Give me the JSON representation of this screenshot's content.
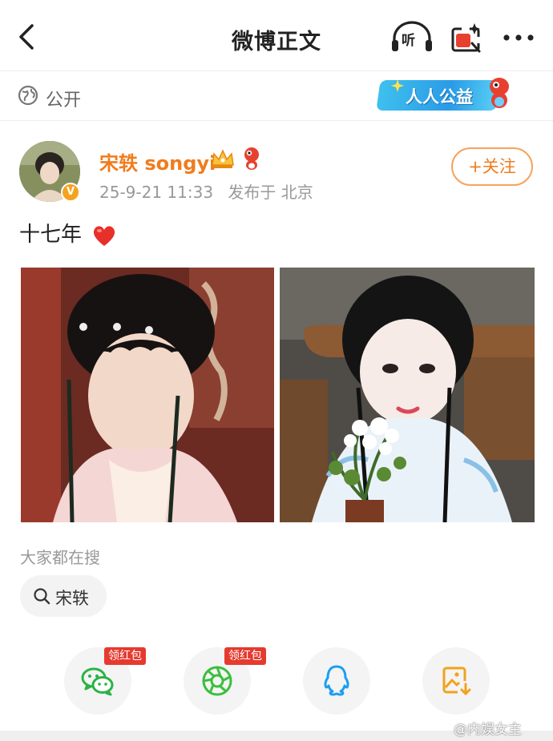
{
  "nav": {
    "title": "微博正文",
    "listen_label": "听"
  },
  "visibility": {
    "label": "公开"
  },
  "charity_badge": {
    "label": "人人公益"
  },
  "post": {
    "author": "宋轶 songyi",
    "verified_badge": "V",
    "timestamp": "25-9-21 11:33",
    "published_from": "发布于 北京",
    "follow_label": "+关注",
    "text": "十七年",
    "emoji": "heart"
  },
  "hot_search": {
    "label": "大家都在搜",
    "chip": "宋轶"
  },
  "share": {
    "buttons": [
      {
        "name": "wechat",
        "badge": "领红包"
      },
      {
        "name": "moments",
        "badge": "领红包"
      },
      {
        "name": "qq",
        "badge": ""
      },
      {
        "name": "save-image",
        "badge": ""
      }
    ]
  },
  "watermark": "@内娱女主",
  "colors": {
    "accent": "#f07c1e",
    "follow_border": "#f5a35d",
    "wechat": "#2bb346",
    "moments": "#3bbf3d",
    "qq": "#1c9ef0",
    "save": "#f2a21c",
    "redpack": "#e63a2f"
  }
}
